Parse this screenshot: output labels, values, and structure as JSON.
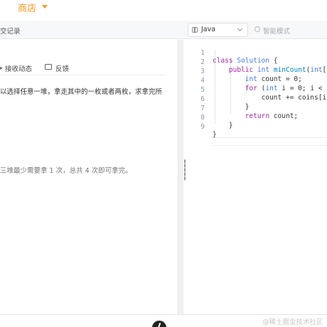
{
  "topbar": {
    "shop_label": "商店"
  },
  "toolbar": {
    "submissions_label": "交记录",
    "language": "Java",
    "smart_mode_label": "智能模式"
  },
  "problem": {
    "receive_updates_label": "接收动态",
    "feedback_label": "反馈",
    "description_line": "以选择任意一堆，拿走其中的一枚或者两枚，求拿完所",
    "explanation_line": "三堆最少需要拿 1 次，总共 4 次即可拿完。"
  },
  "editor": {
    "line_numbers": [
      "1",
      "2",
      "3",
      "4",
      "5",
      "6",
      "7",
      "8"
    ],
    "lines": [
      "class Solution {",
      "    public int minCount(int[] c",
      "        int count = 0;",
      "        for (int i = 0; i < co",
      "            count += coins[i]/",
      "        }",
      "        return count;",
      "    }"
    ],
    "last_line": "}"
  },
  "footer": {
    "watermark": "@稀土掘金技术社区"
  }
}
